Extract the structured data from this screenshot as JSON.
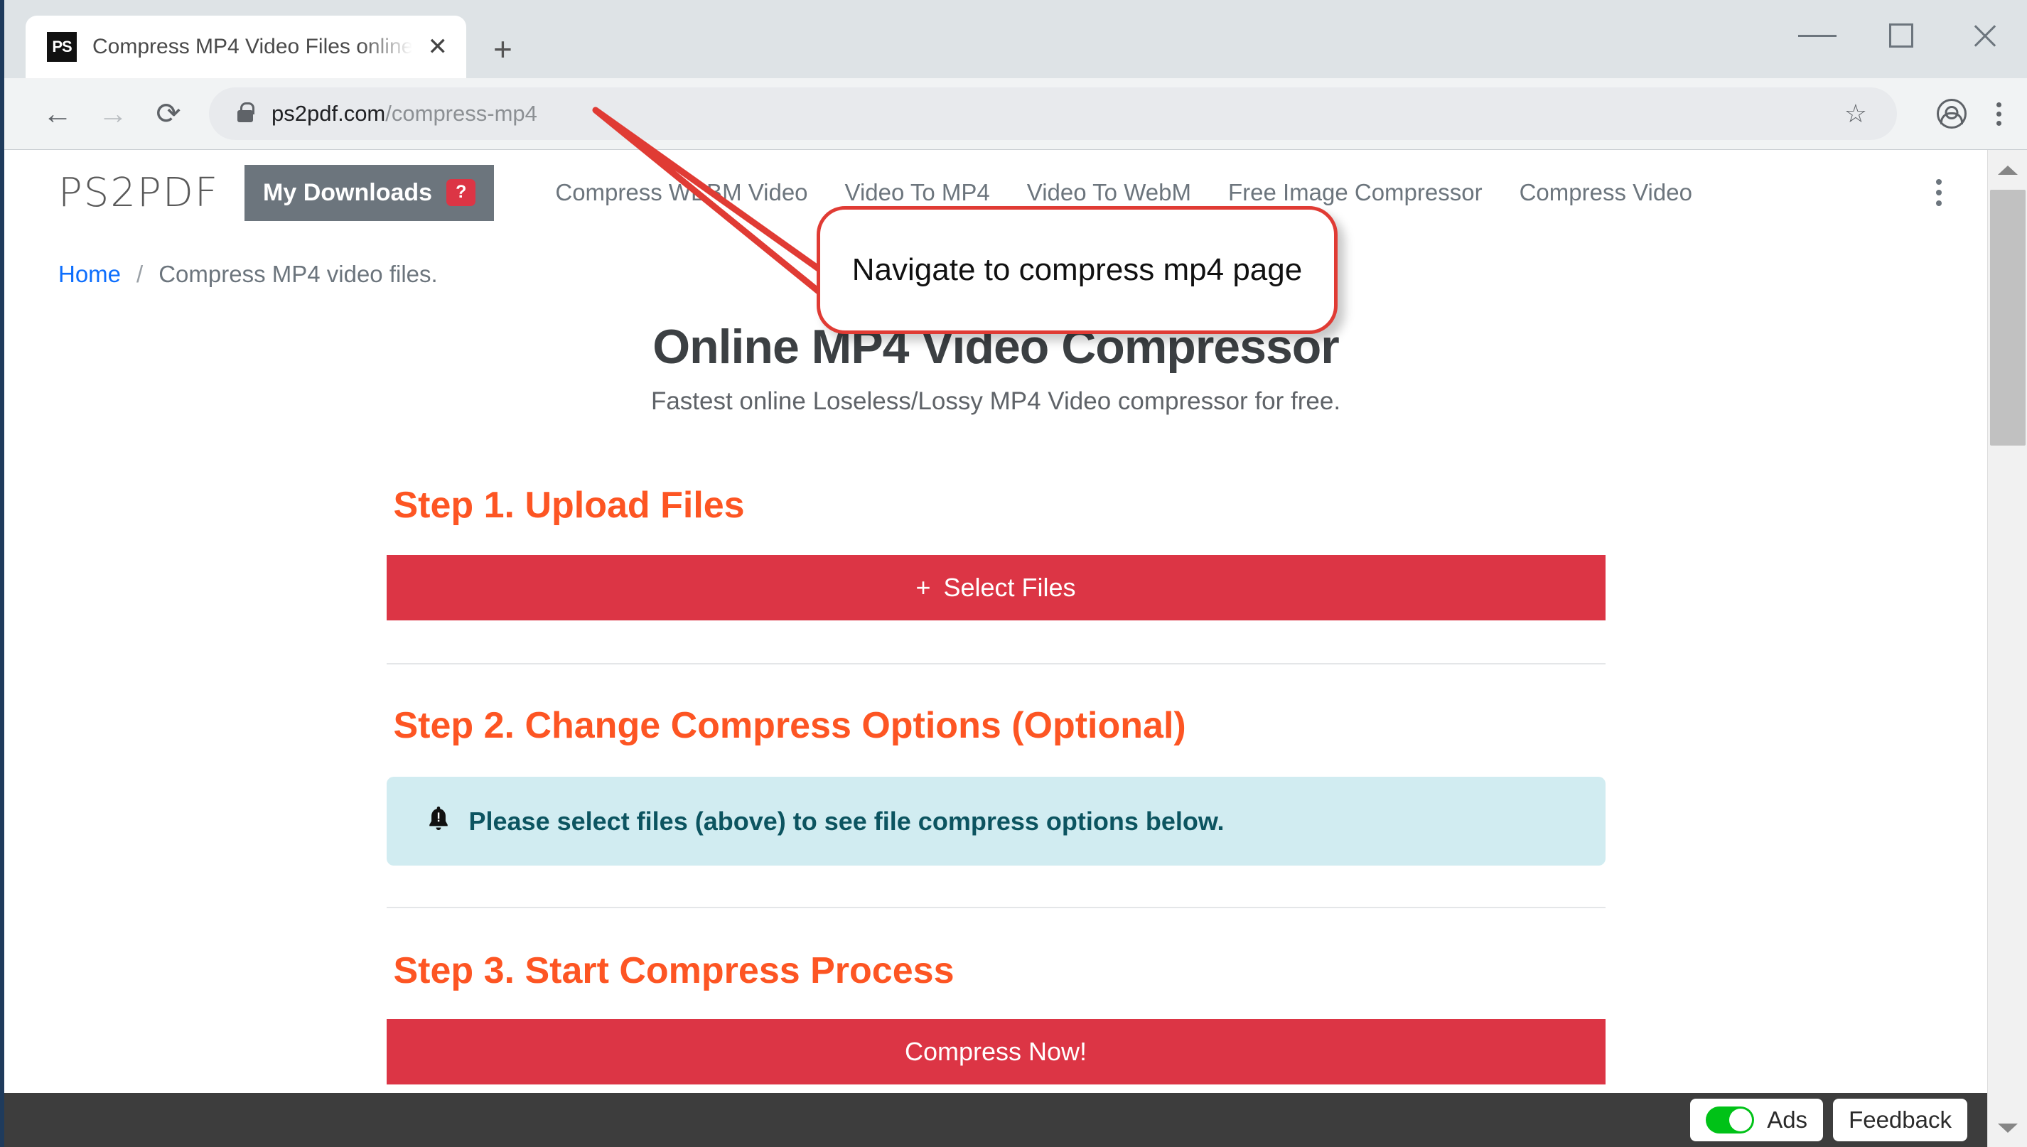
{
  "browser": {
    "tab": {
      "favicon_text": "PS",
      "title": "Compress MP4 Video Files online",
      "close_label": "✕",
      "new_tab_label": "+"
    },
    "window_controls": {
      "minimize": "minimize-button",
      "maximize": "maximize-button",
      "close": "close-button"
    },
    "toolbar": {
      "back_label": "←",
      "forward_label": "→",
      "reload_label": "⟳",
      "star_label": "☆",
      "url_domain": "ps2pdf.com",
      "url_path": "/compress-mp4",
      "url_full": "ps2pdf.com/compress-mp4"
    }
  },
  "site": {
    "brand": "PS2PDF",
    "my_downloads": {
      "label": "My Downloads",
      "badge": "?"
    },
    "nav_links": [
      {
        "label": "Compress WEBM Video"
      },
      {
        "label": "Video To MP4"
      },
      {
        "label": "Video To WebM"
      },
      {
        "label": "Free Image Compressor"
      },
      {
        "label": "Compress Video"
      }
    ],
    "breadcrumb": {
      "home": "Home",
      "separator": "/",
      "current": "Compress MP4 video files."
    },
    "hero": {
      "title": "Online MP4 Video Compressor",
      "subtitle": "Fastest online Loseless/Lossy MP4 Video compressor for free."
    },
    "steps": {
      "step1_title": "Step 1. Upload Files",
      "select_files_plus": "+",
      "select_files_label": "Select Files",
      "step2_title": "Step 2. Change Compress Options (Optional)",
      "alert_text": "Please select files (above) to see file compress options below.",
      "step3_title": "Step 3. Start Compress Process",
      "compress_now_label": "Compress Now!"
    },
    "footer": {
      "ads_label": "Ads",
      "feedback_label": "Feedback"
    }
  },
  "annotation": {
    "callout_text": "Navigate to compress mp4 page"
  },
  "colors": {
    "accent_orange": "#fd5523",
    "accent_red": "#dc3545",
    "nav_gray": "#6c757d",
    "alert_bg": "#d1ecf1",
    "alert_fg": "#0c5460",
    "toggle_green": "#00c217",
    "annotation_red": "#e03b34",
    "link_blue": "#0d6efd"
  }
}
